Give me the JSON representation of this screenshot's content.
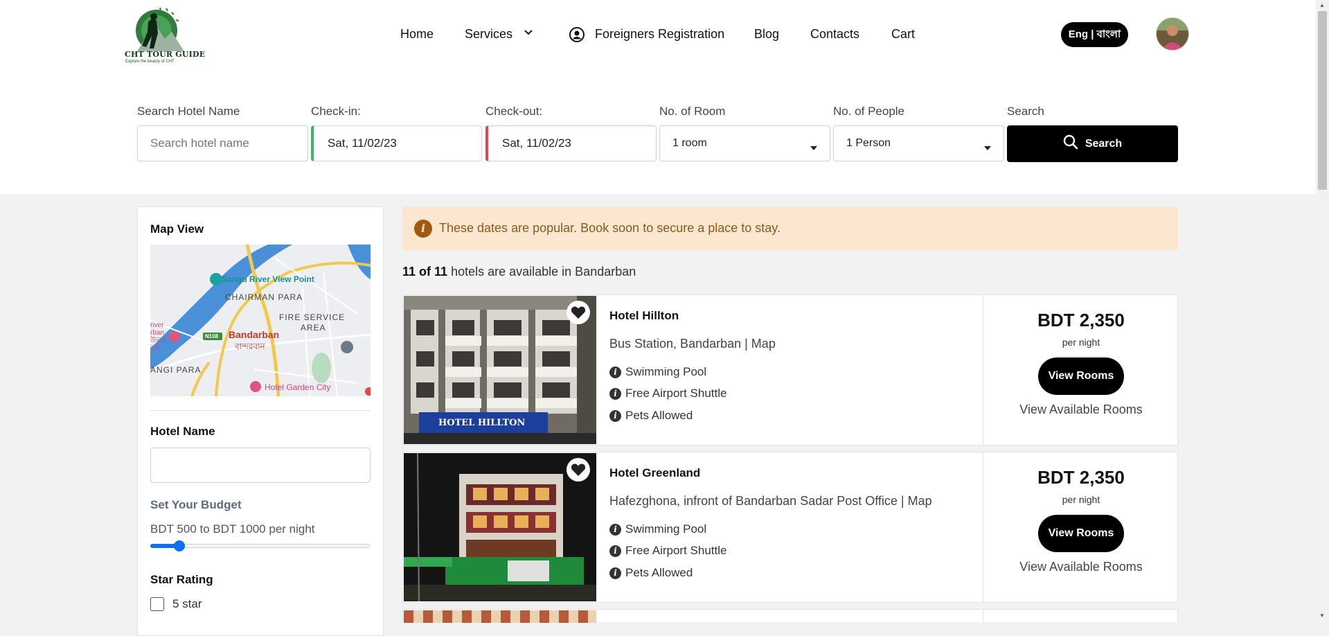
{
  "logo": {
    "title": "CHT TOUR GUIDE",
    "tagline": "Explore the beauty of CHT"
  },
  "nav": {
    "home": "Home",
    "services": "Services",
    "foreigners": "Foreigners Registration",
    "blog": "Blog",
    "contacts": "Contacts",
    "cart": "Cart",
    "language": "Eng | বাংলা"
  },
  "search": {
    "hotel_label": "Search Hotel Name",
    "hotel_placeholder": "Search hotel name",
    "checkin_label": "Check-in:",
    "checkin_value": "Sat, 11/02/23",
    "checkout_label": "Check-out:",
    "checkout_value": "Sat, 11/02/23",
    "rooms_label": "No. of Room",
    "rooms_value": "1 room",
    "people_label": "No. of People",
    "people_value": "1 Person",
    "search_label": "Search",
    "search_button": "Search"
  },
  "sidebar": {
    "map_title": "Map View",
    "map_labels": {
      "river_view": "Sangu River View Point",
      "chairman_para": "CHAIRMAN PARA",
      "fire_service": "FIRE SERVICE",
      "area": "AREA",
      "bandarban": "Bandarban",
      "bandarban_bn": "বান্দরবান",
      "road": "N108",
      "angi_para": "ANGI PARA",
      "garden_city": "Hotel Garden City",
      "river_left_1": "river",
      "river_left_2": "rban",
      "river_left_3": "উভার",
      "river_left_4": "বান"
    },
    "hotel_name_title": "Hotel Name",
    "budget_title": "Set Your Budget",
    "budget_text": "BDT 500 to BDT 1000 per night",
    "budget_slider_fraction": 0.13,
    "star_title": "Star Rating",
    "star_option": "5 star"
  },
  "results": {
    "alert": "These dates are popular. Book soon to secure a place to stay.",
    "count_bold": "11 of 11",
    "count_rest": " hotels are available in Bandarban"
  },
  "hotels": [
    {
      "name": "Hotel Hillton",
      "address": "Bus Station, Bandarban | Map",
      "amenities": [
        "Swimming Pool",
        "Free Airport Shuttle",
        "Pets Allowed"
      ],
      "price": "BDT 2,350",
      "per_night": "per night",
      "button": "View Rooms",
      "available": "View Available Rooms",
      "sign": "HOTEL HILLTON"
    },
    {
      "name": "Hotel Greenland",
      "address": "Hafezghona, infront of Bandarban Sadar Post Office | Map",
      "amenities": [
        "Swimming Pool",
        "Free Airport Shuttle",
        "Pets Allowed"
      ],
      "price": "BDT 2,350",
      "per_night": "per night",
      "button": "View Rooms",
      "available": "View Available Rooms"
    }
  ],
  "colors": {
    "accent_blue": "#0d6efd",
    "checkin_border": "#3bb56a",
    "checkout_border": "#e04848",
    "alert_bg": "#fbe6cf",
    "alert_text": "#8a5a1c",
    "budget_title": "#5b6b80"
  }
}
